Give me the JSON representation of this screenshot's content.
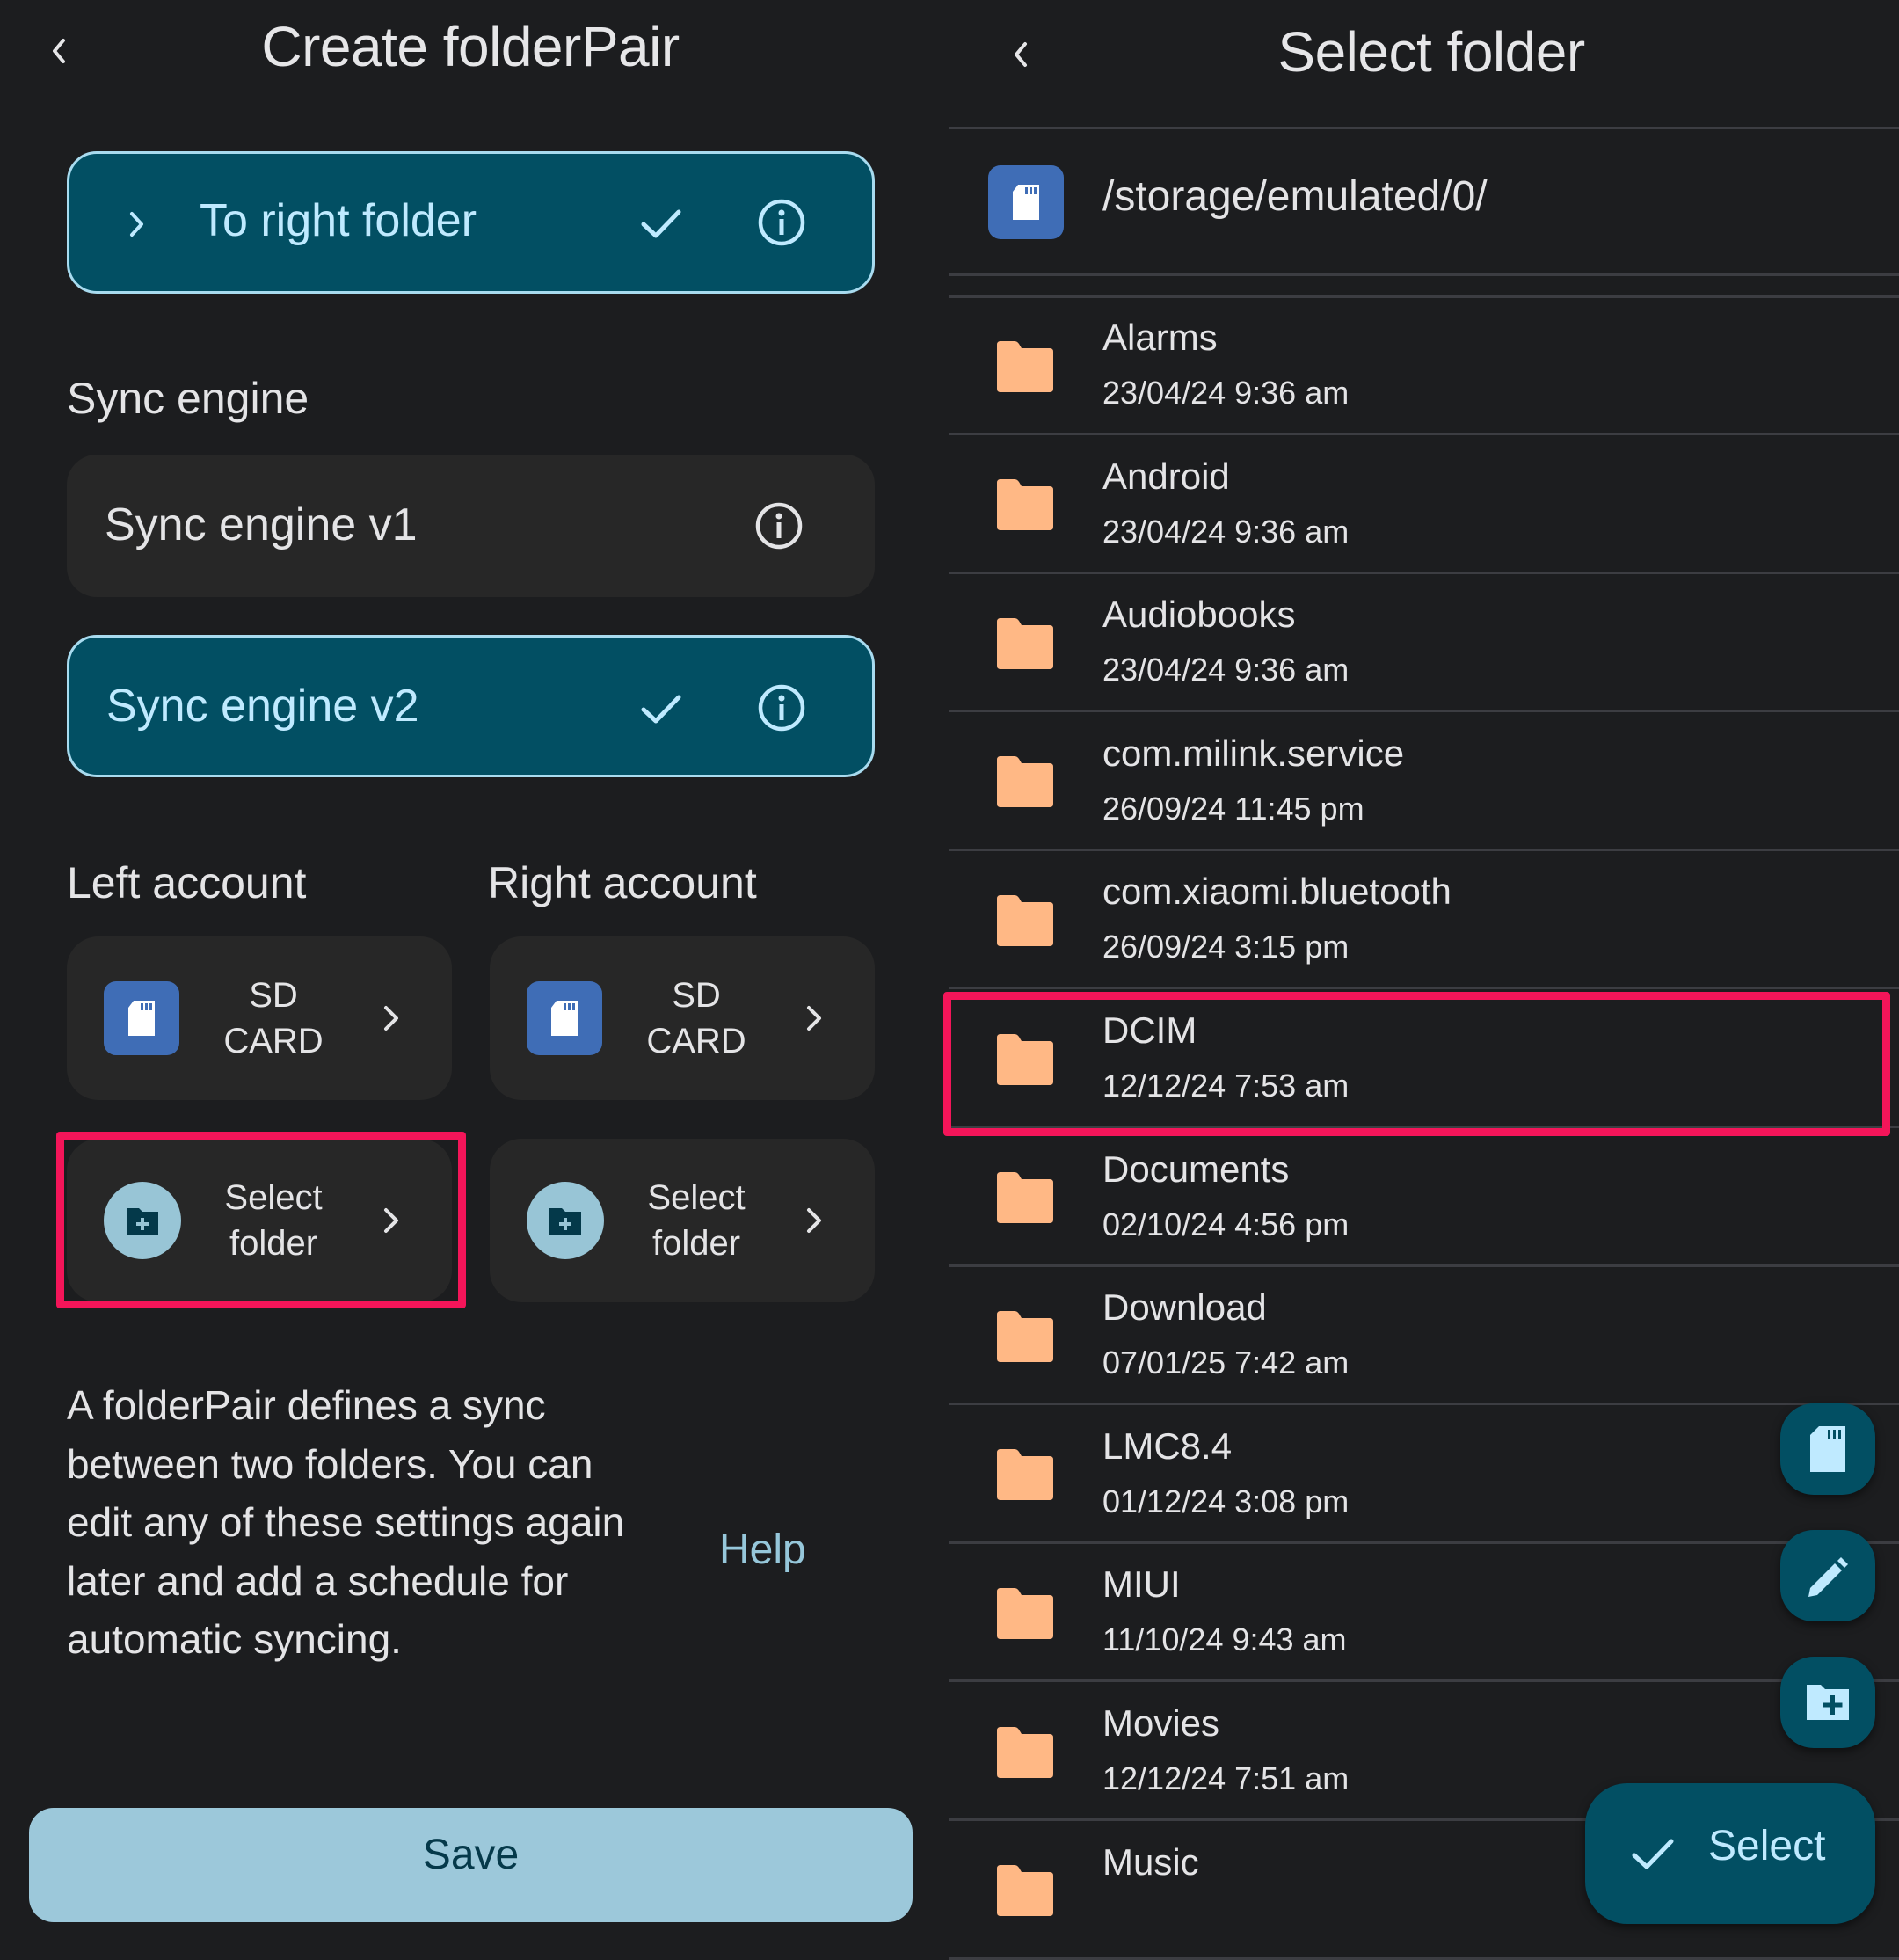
{
  "left_panel": {
    "title": "Create folderPair",
    "direction_option": {
      "label": "To right folder",
      "selected": true
    },
    "sync_engine": {
      "section_label": "Sync engine",
      "options": [
        {
          "label": "Sync engine v1",
          "selected": false
        },
        {
          "label": "Sync engine v2",
          "selected": true
        }
      ]
    },
    "left_account": {
      "section_label": "Left account",
      "storage_line1": "SD",
      "storage_line2": "CARD",
      "folder_line1": "Select",
      "folder_line2": "folder",
      "highlighted": true
    },
    "right_account": {
      "section_label": "Right account",
      "storage_line1": "SD",
      "storage_line2": "CARD",
      "folder_line1": "Select",
      "folder_line2": "folder"
    },
    "description": "A folderPair defines a sync between two folders. You can edit any of these settings again later and add a schedule for automatic syncing.",
    "help_label": "Help",
    "save_label": "Save"
  },
  "right_panel": {
    "title": "Select folder",
    "current_path": "/storage/emulated/0/",
    "folders": [
      {
        "name": "Alarms",
        "modified": "23/04/24 9:36 am"
      },
      {
        "name": "Android",
        "modified": "23/04/24 9:36 am"
      },
      {
        "name": "Audiobooks",
        "modified": "23/04/24 9:36 am"
      },
      {
        "name": "com.milink.service",
        "modified": "26/09/24 11:45 pm"
      },
      {
        "name": "com.xiaomi.bluetooth",
        "modified": "26/09/24 3:15 pm"
      },
      {
        "name": "DCIM",
        "modified": "12/12/24 7:53 am",
        "highlighted": true
      },
      {
        "name": "Documents",
        "modified": "02/10/24 4:56 pm"
      },
      {
        "name": "Download",
        "modified": "07/01/25 7:42 am"
      },
      {
        "name": "LMC8.4",
        "modified": "01/12/24 3:08 pm"
      },
      {
        "name": "MIUI",
        "modified": "11/10/24 9:43 am"
      },
      {
        "name": "Movies",
        "modified": "12/12/24 7:51 am"
      },
      {
        "name": "Music",
        "modified": ""
      }
    ],
    "fabs": [
      "sd-card-icon",
      "pencil-icon",
      "create-folder-icon"
    ],
    "select_label": "Select"
  },
  "colors": {
    "background": "#1c1d1f",
    "card": "#272727",
    "selected_card": "#024f63",
    "accent": "#bfeaff",
    "folder": "#ffb885",
    "sd_badge": "#3f6db6",
    "highlight": "#f31559",
    "save_button": "#9cc8da"
  }
}
